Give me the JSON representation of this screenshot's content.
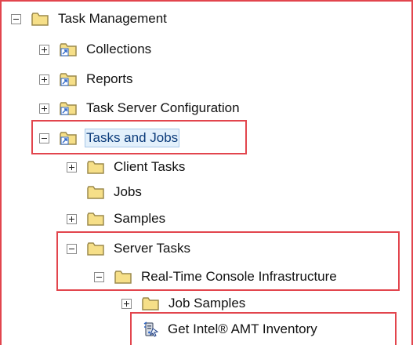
{
  "tree": {
    "nodes": [
      {
        "label": "Task Management",
        "toggle": "minus",
        "icon": "folder-icon"
      },
      {
        "label": "Collections",
        "toggle": "plus",
        "icon": "shortcut-folder-icon"
      },
      {
        "label": "Reports",
        "toggle": "plus",
        "icon": "shortcut-folder-icon"
      },
      {
        "label": "Task Server Configuration",
        "toggle": "plus",
        "icon": "shortcut-folder-icon"
      },
      {
        "label": "Tasks and Jobs",
        "toggle": "minus",
        "icon": "shortcut-folder-icon"
      },
      {
        "label": "Client Tasks",
        "toggle": "plus",
        "icon": "folder-icon"
      },
      {
        "label": "Jobs",
        "toggle": "none",
        "icon": "folder-icon"
      },
      {
        "label": "Samples",
        "toggle": "plus",
        "icon": "folder-icon"
      },
      {
        "label": "Server Tasks",
        "toggle": "minus",
        "icon": "folder-icon"
      },
      {
        "label": "Real-Time Console Infrastructure",
        "toggle": "minus",
        "icon": "folder-icon"
      },
      {
        "label": "Job Samples",
        "toggle": "plus",
        "icon": "folder-icon"
      },
      {
        "label": "Get Intel® AMT Inventory",
        "toggle": "none",
        "icon": "server-task-icon"
      }
    ]
  },
  "colors": {
    "highlight": "#e2454d",
    "folder": "#f6df88",
    "folder_border": "#9c8a4c",
    "shortcut_arrow": "#2c66c9"
  }
}
